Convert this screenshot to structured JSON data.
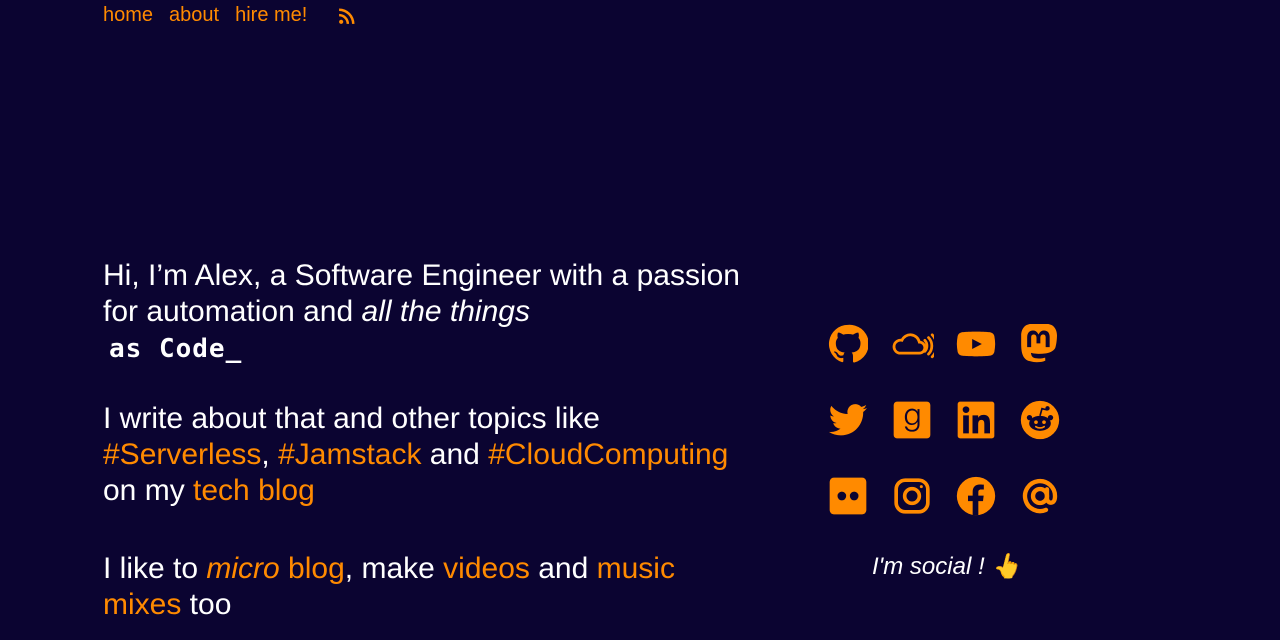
{
  "nav": {
    "home": "home",
    "about": "about",
    "hire": "hire me!",
    "rss_icon": "rss-icon"
  },
  "intro": {
    "line1": "Hi, I’m Alex, a Software Engineer with a passion for automation and ",
    "line1_em": "all the things",
    "code": "as Code_",
    "p2_start": "I write about that and other topics like ",
    "tag1": "#Serverless",
    "sep": ", ",
    "tag2": "#Jamstack",
    "and": " and ",
    "tag3": "#CloudComputing",
    "onmy": " on my ",
    "techblog": "tech blog",
    "p3_start": "I like to ",
    "micro": "micro",
    "blog": " blog",
    "make": ", make ",
    "videos": "videos",
    "and2": " and ",
    "music": "music mixes",
    "too": " too"
  },
  "social": {
    "icons": [
      "github-icon",
      "soundcloud-icon",
      "youtube-icon",
      "mastodon-icon",
      "twitter-icon",
      "goodreads-icon",
      "linkedin-icon",
      "reddit-icon",
      "flickr-icon",
      "instagram-icon",
      "facebook-icon",
      "email-icon"
    ],
    "caption": "I'm social ! 👆"
  },
  "colors": {
    "background": "#0b0431",
    "accent": "#ff8a00",
    "text": "#ffffff"
  }
}
